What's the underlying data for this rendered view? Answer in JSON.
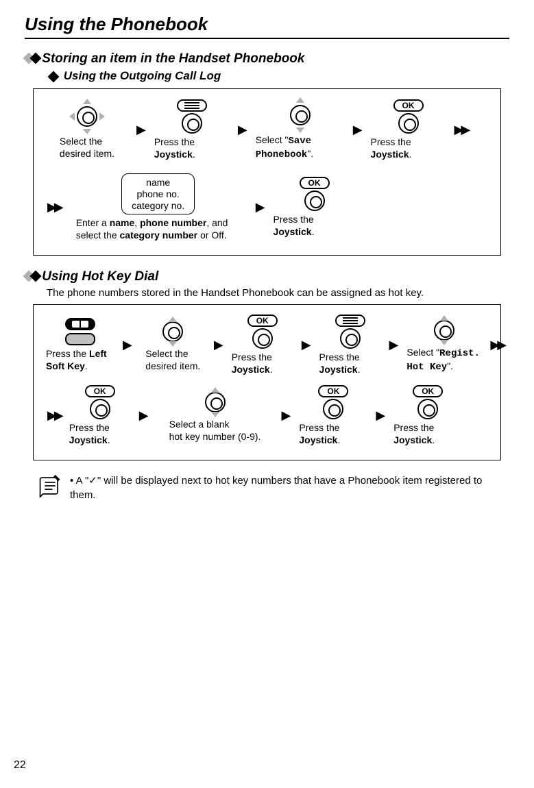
{
  "page_title": "Using the Phonebook",
  "page_number": "22",
  "sec1": {
    "heading": "Storing an item in the Handset Phonebook",
    "subheading": "Using the Outgoing Call Log",
    "steps": {
      "s1": {
        "text_a": "Select the",
        "text_b": "desired item."
      },
      "s2": {
        "text_a": "Press the ",
        "bold": "Joystick",
        "tail": "."
      },
      "s3": {
        "text_a": "Select \"",
        "mono": "Save Phonebook",
        "tail": "\"."
      },
      "s4": {
        "text_a": "Press the ",
        "bold": "Joystick",
        "tail": "."
      },
      "entry": {
        "l1": "name",
        "l2": "phone no.",
        "l3": "category no."
      },
      "s5": {
        "pre": "Enter a ",
        "b1": "name",
        "mid1": ", ",
        "b2": "phone number",
        "mid2": ", and select the ",
        "b3": "category number",
        "tail": " or Off."
      },
      "s6": {
        "text_a": "Press the ",
        "bold": "Joystick",
        "tail": "."
      }
    }
  },
  "sec2": {
    "heading": "Using Hot Key Dial",
    "intro": "The phone numbers stored in the Handset Phonebook can be assigned as hot key.",
    "steps": {
      "t1": {
        "text_a": "Press the ",
        "bold": "Left Soft Key",
        "tail": "."
      },
      "t2": {
        "text_a": "Select the",
        "text_b": "desired item."
      },
      "t3": {
        "text_a": "Press the ",
        "bold": "Joystick",
        "tail": "."
      },
      "t4": {
        "text_a": "Press the ",
        "bold": "Joystick",
        "tail": "."
      },
      "t5": {
        "text_a": "Select \"",
        "mono": "Regist. Hot Key",
        "tail": "\"."
      },
      "t6": {
        "text_a": "Press the ",
        "bold": "Joystick",
        "tail": "."
      },
      "t7": {
        "text_a": "Select a blank",
        "text_b": "hot key number (0-9)."
      },
      "t8": {
        "text_a": "Press the ",
        "bold": "Joystick",
        "tail": "."
      },
      "t9": {
        "text_a": "Press the ",
        "bold": "Joystick",
        "tail": "."
      }
    }
  },
  "note": {
    "bullet": "•",
    "pre": " A \"",
    "check": "✓",
    "post": "\" will be displayed next to hot key numbers that have a Phonebook item registered to them."
  },
  "ok_label": "OK"
}
